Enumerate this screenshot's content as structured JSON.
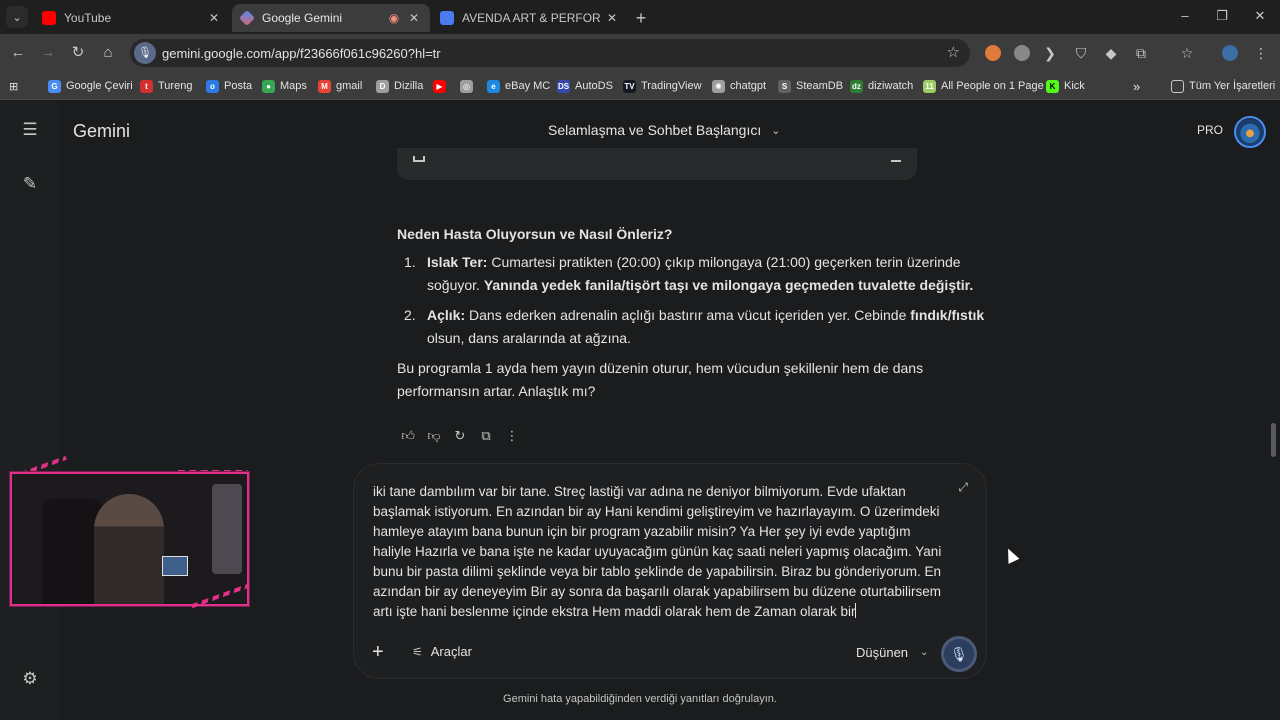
{
  "browser": {
    "tabs": [
      {
        "title": "YouTube",
        "active": false,
        "favicon_color": "#ff0000"
      },
      {
        "title": "Google Gemini",
        "active": true,
        "favicon_color": "#4f8df5"
      },
      {
        "title": "AVENDA ART & PERFORMANCE",
        "active": false,
        "favicon_color": "#4a7cf0"
      }
    ],
    "url": "gemini.google.com/app/f23666f061c96260?hl=tr",
    "window_controls": {
      "minimize": "–",
      "restore": "❐",
      "close": "✕"
    }
  },
  "bookmarks": {
    "items": [
      {
        "label": "Google Çeviri",
        "color": "#4a8df0",
        "glyph": "G"
      },
      {
        "label": "Tureng",
        "color": "#d32f2f",
        "glyph": "t"
      },
      {
        "label": "Posta",
        "color": "#2c7be5",
        "glyph": "o"
      },
      {
        "label": "Maps",
        "color": "#34a853",
        "glyph": "●"
      },
      {
        "label": "gmail",
        "color": "#ea4335",
        "glyph": "M"
      },
      {
        "label": "Dizilla",
        "color": "#9e9e9e",
        "glyph": "D"
      },
      {
        "label": "",
        "color": "#ff0000",
        "glyph": "▶"
      },
      {
        "label": "",
        "color": "#9e9e9e",
        "glyph": "◎"
      },
      {
        "label": "eBay MC",
        "color": "#1e88e5",
        "glyph": "e"
      },
      {
        "label": "AutoDS",
        "color": "#3949ab",
        "glyph": "DS"
      },
      {
        "label": "TradingView",
        "color": "#131722",
        "glyph": "TV"
      },
      {
        "label": "chatgpt",
        "color": "#9e9e9e",
        "glyph": "✺"
      },
      {
        "label": "SteamDB",
        "color": "#616161",
        "glyph": "S"
      },
      {
        "label": "diziwatch",
        "color": "#2e7d32",
        "glyph": "dz"
      },
      {
        "label": "All People on 1 Page",
        "color": "#9ccc65",
        "glyph": "11"
      },
      {
        "label": "Kick",
        "color": "#53fc18",
        "glyph": "K"
      }
    ],
    "more": "»",
    "all_bookmarks": "Tüm Yer İşaretleri"
  },
  "gemini": {
    "brand": "Gemini",
    "conversation_title": "Selamlaşma ve Sohbet Başlangıcı",
    "pro_label": "PRO",
    "response": {
      "heading": "Neden Hasta Oluyorsun ve Nasıl Önleriz?",
      "items": [
        {
          "num": "1.",
          "term": "Islak Ter:",
          "text": " Cumartesi pratikten (20:00) çıkıp milongaya (21:00) geçerken terin üzerinde soğuyor. ",
          "bold_tail": "Yanında yedek fanila/tişört taşı ve milongaya geçmeden tuvalette değiştir.",
          "tail": ""
        },
        {
          "num": "2.",
          "term": "Açlık:",
          "text": " Dans ederken adrenalin açlığı bastırır ama vücut içeriden yer. Cebinde ",
          "bold_tail": "fındık/fıstık",
          "tail": " olsun, dans aralarında at ağzına."
        }
      ],
      "closing": "Bu programla 1 ayda hem yayın düzenin oturur, hem vücudun şekillenir hem de dans performansın artar. Anlaştık mı?"
    },
    "prompt_text": "iki tane dambılım var bir tane. Streç lastiği var adına ne deniyor bilmiyorum. Evde ufaktan başlamak istiyorum. En azından bir ay Hani kendimi geliştireyim ve hazırlayayım. O üzerimdeki hamleye atayım bana bunun için bir program yazabilir misin? Ya Her şey iyi evde yaptığım haliyle Hazırla ve bana işte ne kadar uyuyacağım günün kaç saati neleri yapmış olacağım. Yani bunu bir pasta dilimi şeklinde veya bir tablo şeklinde de yapabilirsin. Biraz bu gönderiyorum. En azından bir ay deneyeyim Bir ay sonra da başarılı olarak yapabilirsem bu düzene oturtabilirsem artı işte hani beslenme içinde ekstra Hem maddi olarak hem de Zaman olarak bir",
    "tools_label": "Araçlar",
    "mode_label": "Düşünen",
    "disclaimer": "Gemini hata yapabildiğinden verdiği yanıtları doğrulayın."
  }
}
